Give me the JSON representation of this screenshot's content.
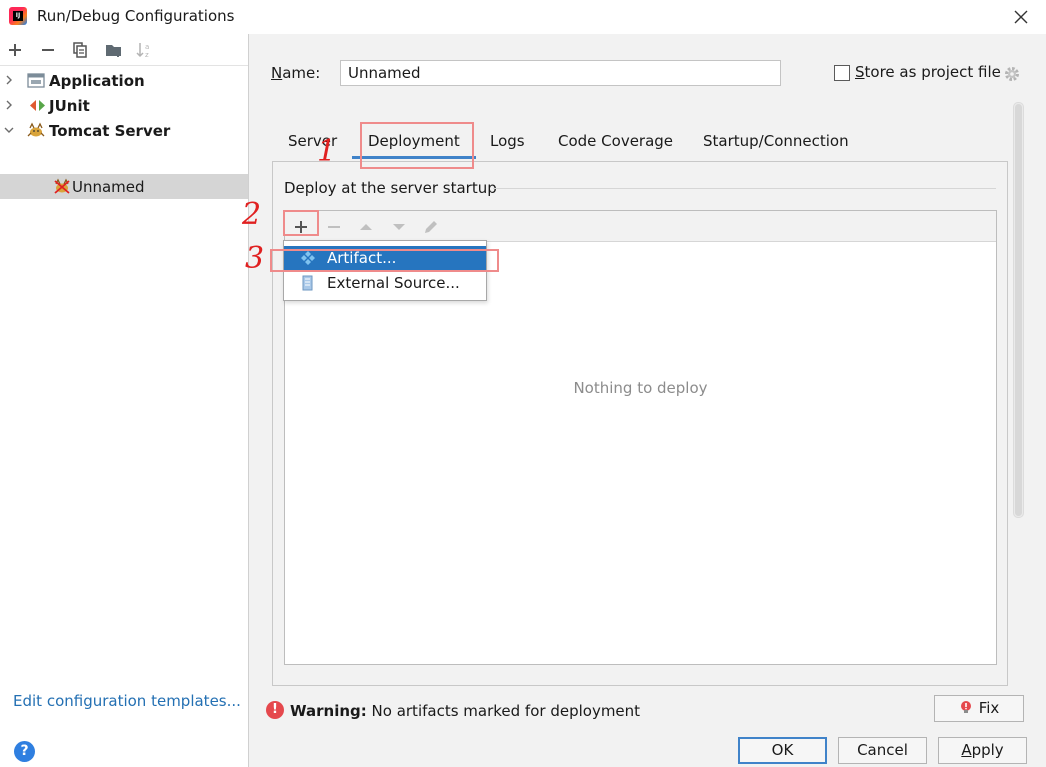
{
  "window": {
    "title": "Run/Debug Configurations"
  },
  "left_panel": {
    "toolbar_icons": [
      "add-icon",
      "remove-icon",
      "copy-icon",
      "folder-icon",
      "sort-icon"
    ],
    "tree": [
      {
        "label": "Application",
        "icon": "application-icon",
        "expanded": false,
        "level": 0
      },
      {
        "label": "JUnit",
        "icon": "junit-icon",
        "expanded": false,
        "level": 0
      },
      {
        "label": "Tomcat Server",
        "icon": "tomcat-icon",
        "expanded": true,
        "level": 0
      },
      {
        "label": "Unnamed",
        "icon": "tomcat-error-icon",
        "level": 1,
        "selected": true
      }
    ],
    "edit_templates_link": "Edit configuration templates...",
    "help_label": "?"
  },
  "form": {
    "name_label_mnemonic": "N",
    "name_label_rest": "ame:",
    "name_value": "Unnamed",
    "store_mnemonic": "S",
    "store_rest": "tore as project file",
    "store_checked": false
  },
  "tabs": [
    {
      "label": "Server",
      "active": false
    },
    {
      "label": "Deployment",
      "active": true
    },
    {
      "label": "Logs",
      "active": false
    },
    {
      "label": "Code Coverage",
      "active": false
    },
    {
      "label": "Startup/Connection",
      "active": false
    }
  ],
  "deployment": {
    "group_title": "Deploy at the server startup",
    "empty_text": "Nothing to deploy",
    "toolbar_icons": [
      "add-icon",
      "remove-icon",
      "move-up-icon",
      "move-down-icon",
      "edit-icon"
    ]
  },
  "popup_menu": {
    "items": [
      {
        "label": "Artifact...",
        "icon": "artifact-icon",
        "selected": true
      },
      {
        "label": "External Source...",
        "icon": "external-source-icon",
        "selected": false
      }
    ]
  },
  "warning": {
    "bold": "Warning:",
    "message": " No artifacts marked for deployment"
  },
  "buttons": {
    "fix": "Fix",
    "ok": "OK",
    "cancel": "Cancel",
    "apply_mnemonic": "A",
    "apply_rest": "pply"
  },
  "annotations": {
    "step1": "1",
    "step2": "2",
    "step3": "3"
  },
  "colors": {
    "accent": "#4083c9",
    "selection": "#2675bf",
    "annotation": "#e02020",
    "link": "#2470b3",
    "warning": "#e5484d"
  }
}
